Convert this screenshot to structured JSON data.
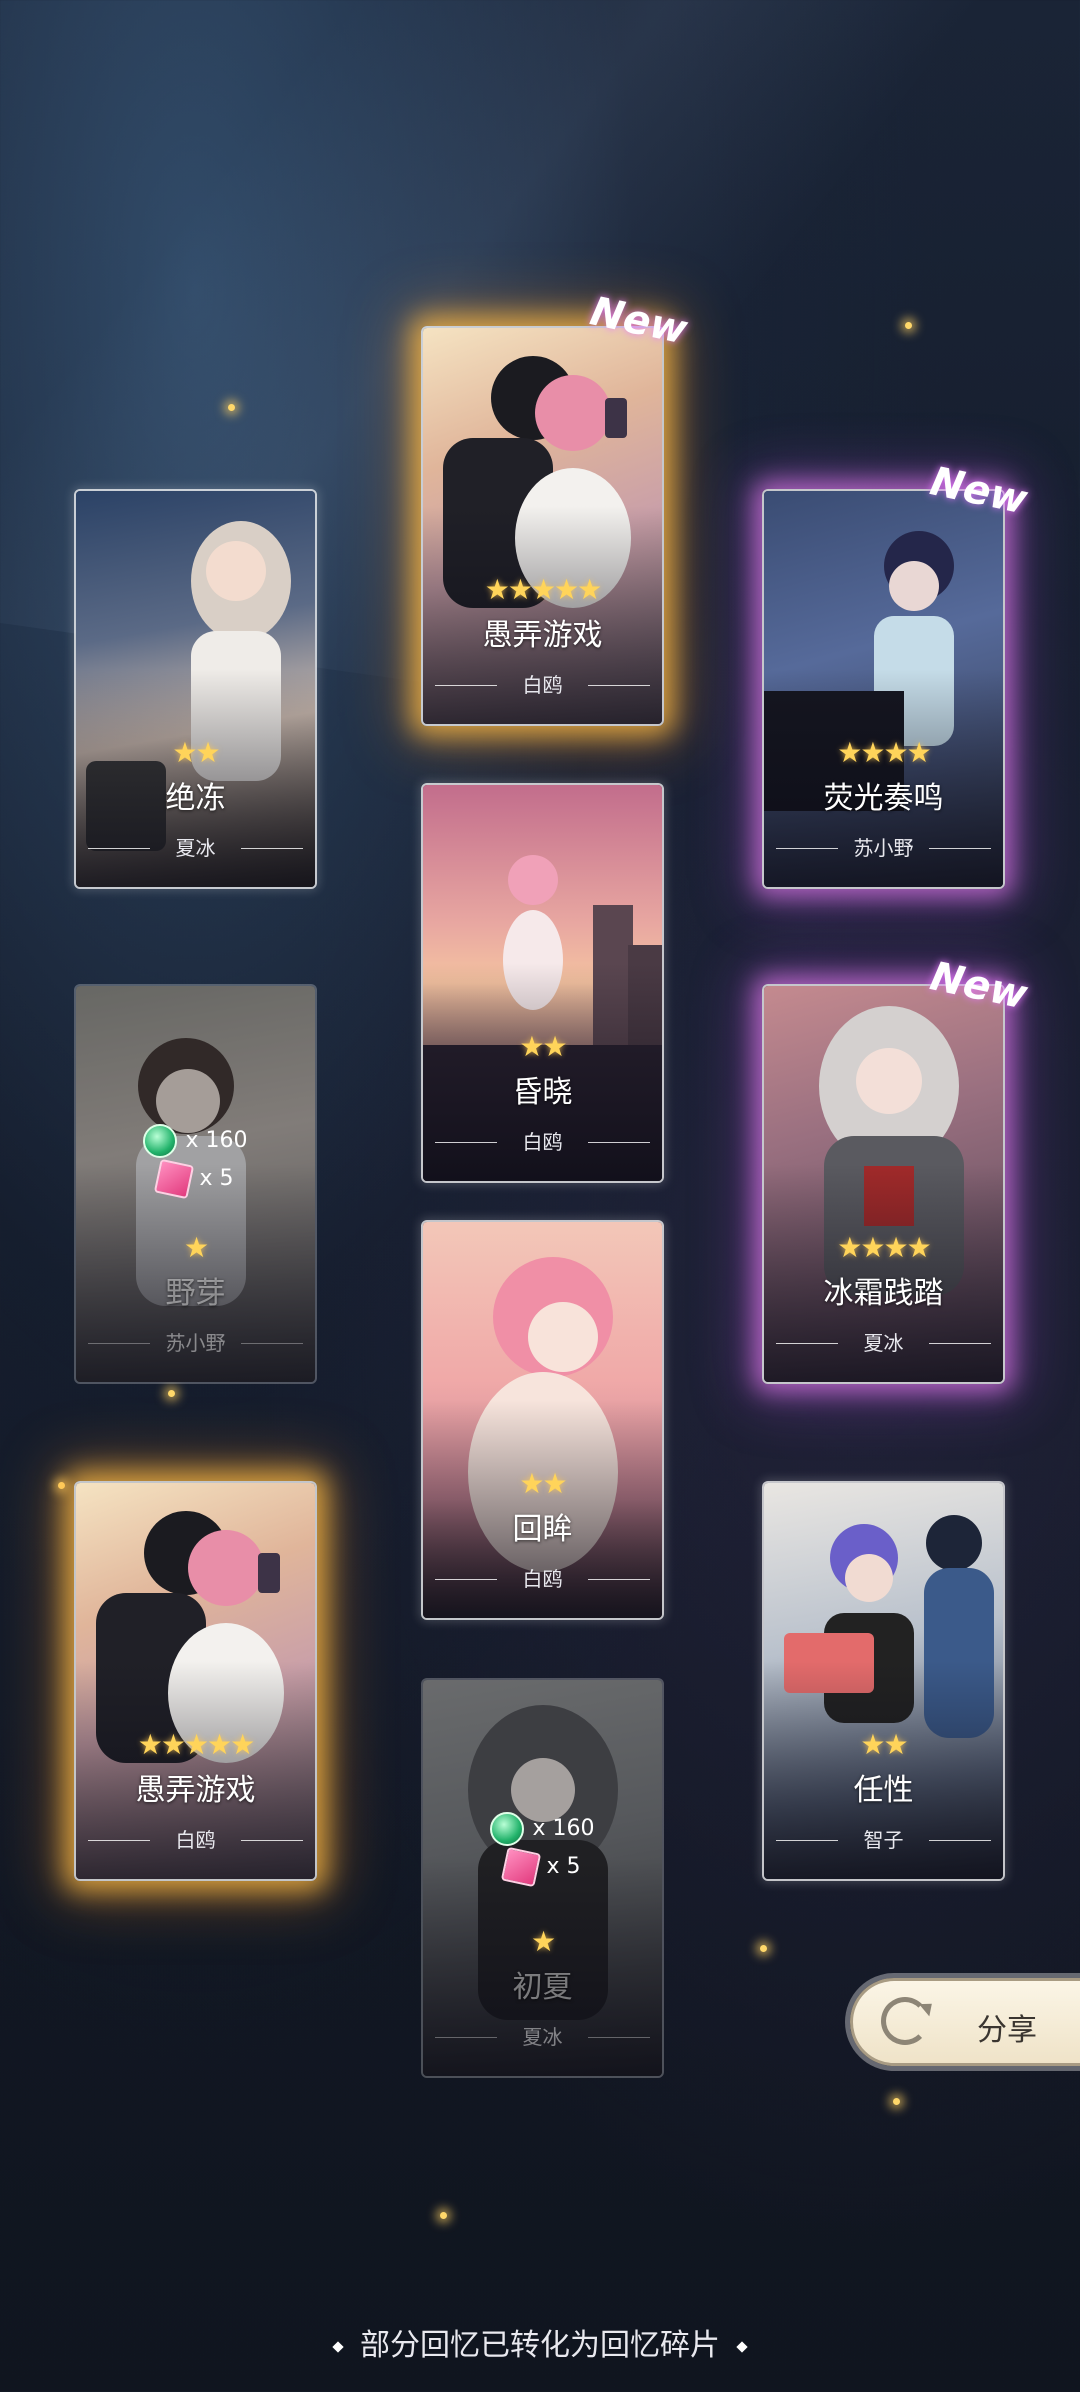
{
  "cards": [
    {
      "id": "c1",
      "title": "愚弄游戏",
      "author": "白鸥",
      "stars": "★★★★★",
      "new_badge": "New",
      "rewards": null
    },
    {
      "id": "c2",
      "title": "绝冻",
      "author": "夏冰",
      "stars": "★★",
      "new_badge": "",
      "rewards": null
    },
    {
      "id": "c3",
      "title": "荧光奏鸣",
      "author": "苏小野",
      "stars": "★★★★",
      "new_badge": "New",
      "rewards": null
    },
    {
      "id": "c4",
      "title": "昏晓",
      "author": "白鸥",
      "stars": "★★",
      "new_badge": "",
      "rewards": null
    },
    {
      "id": "c5",
      "title": "野芽",
      "author": "苏小野",
      "stars": "★",
      "new_badge": "",
      "rewards": {
        "gem": "x 160",
        "cube": "x 5"
      }
    },
    {
      "id": "c6",
      "title": "冰霜践踏",
      "author": "夏冰",
      "stars": "★★★★",
      "new_badge": "New",
      "rewards": null
    },
    {
      "id": "c7",
      "title": "回眸",
      "author": "白鸥",
      "stars": "★★",
      "new_badge": "",
      "rewards": null
    },
    {
      "id": "c8",
      "title": "愚弄游戏",
      "author": "白鸥",
      "stars": "★★★★★",
      "new_badge": "",
      "rewards": null
    },
    {
      "id": "c9",
      "title": "任性",
      "author": "智子",
      "stars": "★★",
      "new_badge": "",
      "rewards": null
    },
    {
      "id": "c10",
      "title": "初夏",
      "author": "夏冰",
      "stars": "★",
      "new_badge": "",
      "rewards": {
        "gem": "x 160",
        "cube": "x 5"
      }
    }
  ],
  "share_label": "分享",
  "footer_text": "部分回忆已转化为回忆碎片",
  "colors": {
    "gold_glow": "#ffbe46",
    "purple_glow": "#dc78e6",
    "star": "#ffd45a"
  }
}
